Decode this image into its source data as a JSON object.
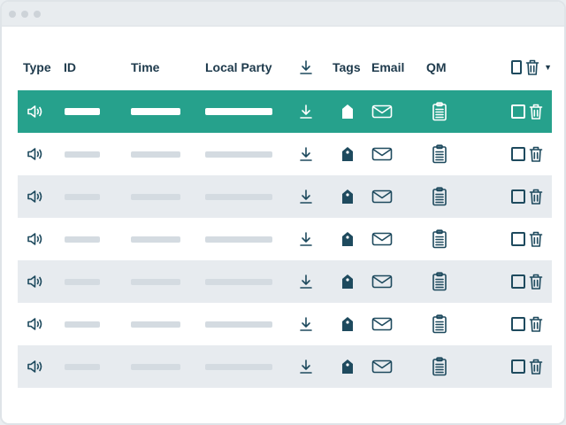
{
  "window": {
    "title_dots": 3
  },
  "table": {
    "headers": {
      "type": "Type",
      "id": "ID",
      "time": "Time",
      "local_party": "Local Party",
      "download_icon": "download-icon",
      "tags": "Tags",
      "email": "Email",
      "qm": "QM",
      "select_all_icon": "checkbox-icon",
      "delete_all_icon": "trash-icon",
      "menu_icon": "caret-down-icon"
    },
    "rows": [
      {
        "state": "selected",
        "type_icon": "speaker-icon"
      },
      {
        "state": "normal",
        "type_icon": "speaker-icon"
      },
      {
        "state": "alt",
        "type_icon": "speaker-icon"
      },
      {
        "state": "normal",
        "type_icon": "speaker-icon"
      },
      {
        "state": "alt",
        "type_icon": "speaker-icon"
      },
      {
        "state": "normal",
        "type_icon": "speaker-icon"
      },
      {
        "state": "alt",
        "type_icon": "speaker-icon"
      }
    ]
  },
  "colors": {
    "accent": "#26a18c",
    "icon": "#1e4a5e",
    "header_text": "#1e3a4c",
    "alt_row": "#e7ebef",
    "placeholder": "#d4dbe1"
  }
}
